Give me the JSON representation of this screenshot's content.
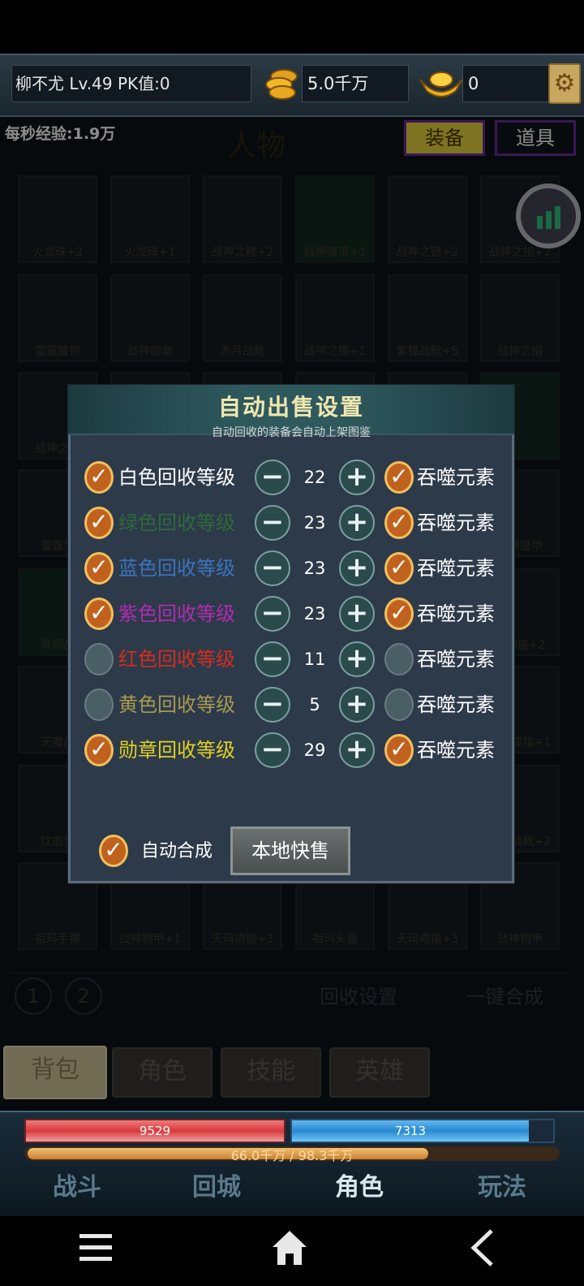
{
  "header": {
    "player": "柳不尤  Lv.49 PK值:0",
    "gold": "5.0千万",
    "ingot": "0",
    "exp_per_sec": "每秒经验:1.9万",
    "equip_btn": "装备",
    "items_btn": "道具",
    "panel_title": "人物"
  },
  "background": {
    "slots": [
      "火龙珠+2",
      "火龙珠+1",
      "战神之靴+2",
      "战神腰带+1",
      "战神之链+2",
      "战神之指+2",
      "雷霆腰带",
      "战神勋章",
      "赤月战靴",
      "战神之镯+1",
      "紫锦战靴+5",
      "战神之指",
      "战神之刃",
      "",
      "",
      "",
      "",
      "",
      "雷霆手",
      "",
      "",
      "",
      "",
      "战神腰甲",
      "青铜战",
      "",
      "",
      "",
      "",
      "战神链+2",
      "天魔战",
      "",
      "",
      "",
      "",
      "战神戒指+1",
      "饮血剑",
      "",
      "",
      "",
      "",
      "战神战靴+2",
      "祖玛手镯",
      "战神铜甲+1",
      "天玛项链+3",
      "祖玛头盔",
      "天玛戒指+3",
      "战神铜甲"
    ],
    "pages": [
      "1",
      "2"
    ],
    "recycle_settings": "回收设置",
    "one_click_merge": "一键合成"
  },
  "tabs": [
    "背包",
    "角色",
    "技能",
    "英雄"
  ],
  "hud": {
    "hp": "9529",
    "mp": "7313",
    "exp_text": "66.0千万 / 98.3千万",
    "buttons": [
      "战斗",
      "回城",
      "角色",
      "玩法"
    ]
  },
  "dialog": {
    "title": "自动出售设置",
    "subtitle": "自动回收的装备会自动上架图鉴",
    "rows": [
      {
        "label": "白色回收等级",
        "color": "#ffffff",
        "value": "22",
        "checked": true,
        "devour": "吞噬元素",
        "devour_checked": true
      },
      {
        "label": "绿色回收等级",
        "color": "#2e6a3a",
        "value": "23",
        "checked": true,
        "devour": "吞噬元素",
        "devour_checked": true
      },
      {
        "label": "蓝色回收等级",
        "color": "#3a74c0",
        "value": "23",
        "checked": true,
        "devour": "吞噬元素",
        "devour_checked": true
      },
      {
        "label": "紫色回收等级",
        "color": "#b02cb0",
        "value": "23",
        "checked": true,
        "devour": "吞噬元素",
        "devour_checked": true
      },
      {
        "label": "红色回收等级",
        "color": "#d42c1e",
        "value": "11",
        "checked": false,
        "devour": "吞噬元素",
        "devour_checked": false
      },
      {
        "label": "黄色回收等级",
        "color": "#a89a50",
        "value": "5",
        "checked": false,
        "devour": "吞噬元素",
        "devour_checked": false
      },
      {
        "label": "勋章回收等级",
        "color": "#e0d020",
        "value": "29",
        "checked": true,
        "devour": "吞噬元素",
        "devour_checked": true
      }
    ],
    "auto_merge": "自动合成",
    "auto_merge_checked": true,
    "quick_sell": "本地快售"
  },
  "icons": {
    "coin": "gold-coin-icon",
    "ingot": "gold-ingot-icon",
    "settings": "gear-icon",
    "stats": "bar-chart-icon",
    "nav": [
      "menu-icon",
      "home-icon",
      "back-icon"
    ]
  }
}
